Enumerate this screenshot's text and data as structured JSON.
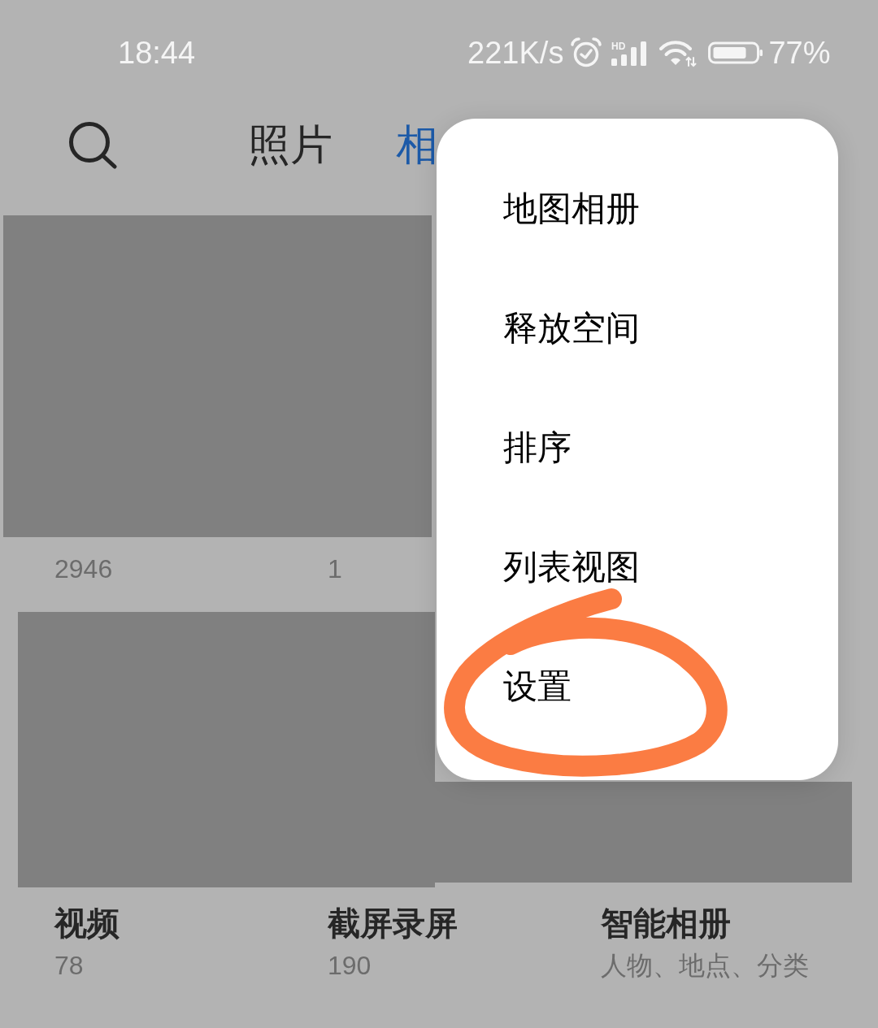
{
  "status_bar": {
    "time": "18:44",
    "network_speed": "221K/s",
    "network_type": "HD",
    "battery": "77%"
  },
  "toolbar": {
    "tabs": [
      {
        "label": "照片",
        "selected": false
      },
      {
        "label": "相",
        "selected": true
      }
    ]
  },
  "album_rows": [
    [
      {
        "count": "2946"
      },
      {
        "count": "1"
      }
    ],
    [
      {
        "name": "视频",
        "count": "78"
      },
      {
        "name": "截屏录屏",
        "count": "190"
      },
      {
        "name": "智能相册",
        "subtitle": "人物、地点、分类"
      }
    ]
  ],
  "menu": {
    "items": [
      {
        "label": "地图相册",
        "circled": false
      },
      {
        "label": "释放空间",
        "circled": false
      },
      {
        "label": "排序",
        "circled": false
      },
      {
        "label": "列表视图",
        "circled": false
      },
      {
        "label": "设置",
        "circled": true
      }
    ]
  }
}
